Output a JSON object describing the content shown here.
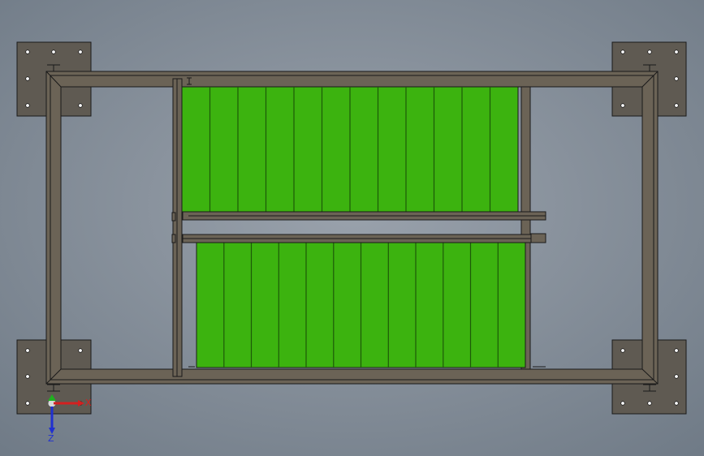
{
  "colors": {
    "background_center": "#9aa2ac",
    "background_edge": "#6f7a86",
    "frame_fill": "#6b6356",
    "frame_stroke": "#1a1a1a",
    "plate_fill": "#5f5a52",
    "panel_fill": "#3cb30f",
    "panel_line": "#1d5a08",
    "axis_x": "#d42020",
    "axis_y": "#20b020",
    "axis_z": "#2030d0"
  },
  "triad": {
    "x_label": "X",
    "z_label": "Z"
  }
}
